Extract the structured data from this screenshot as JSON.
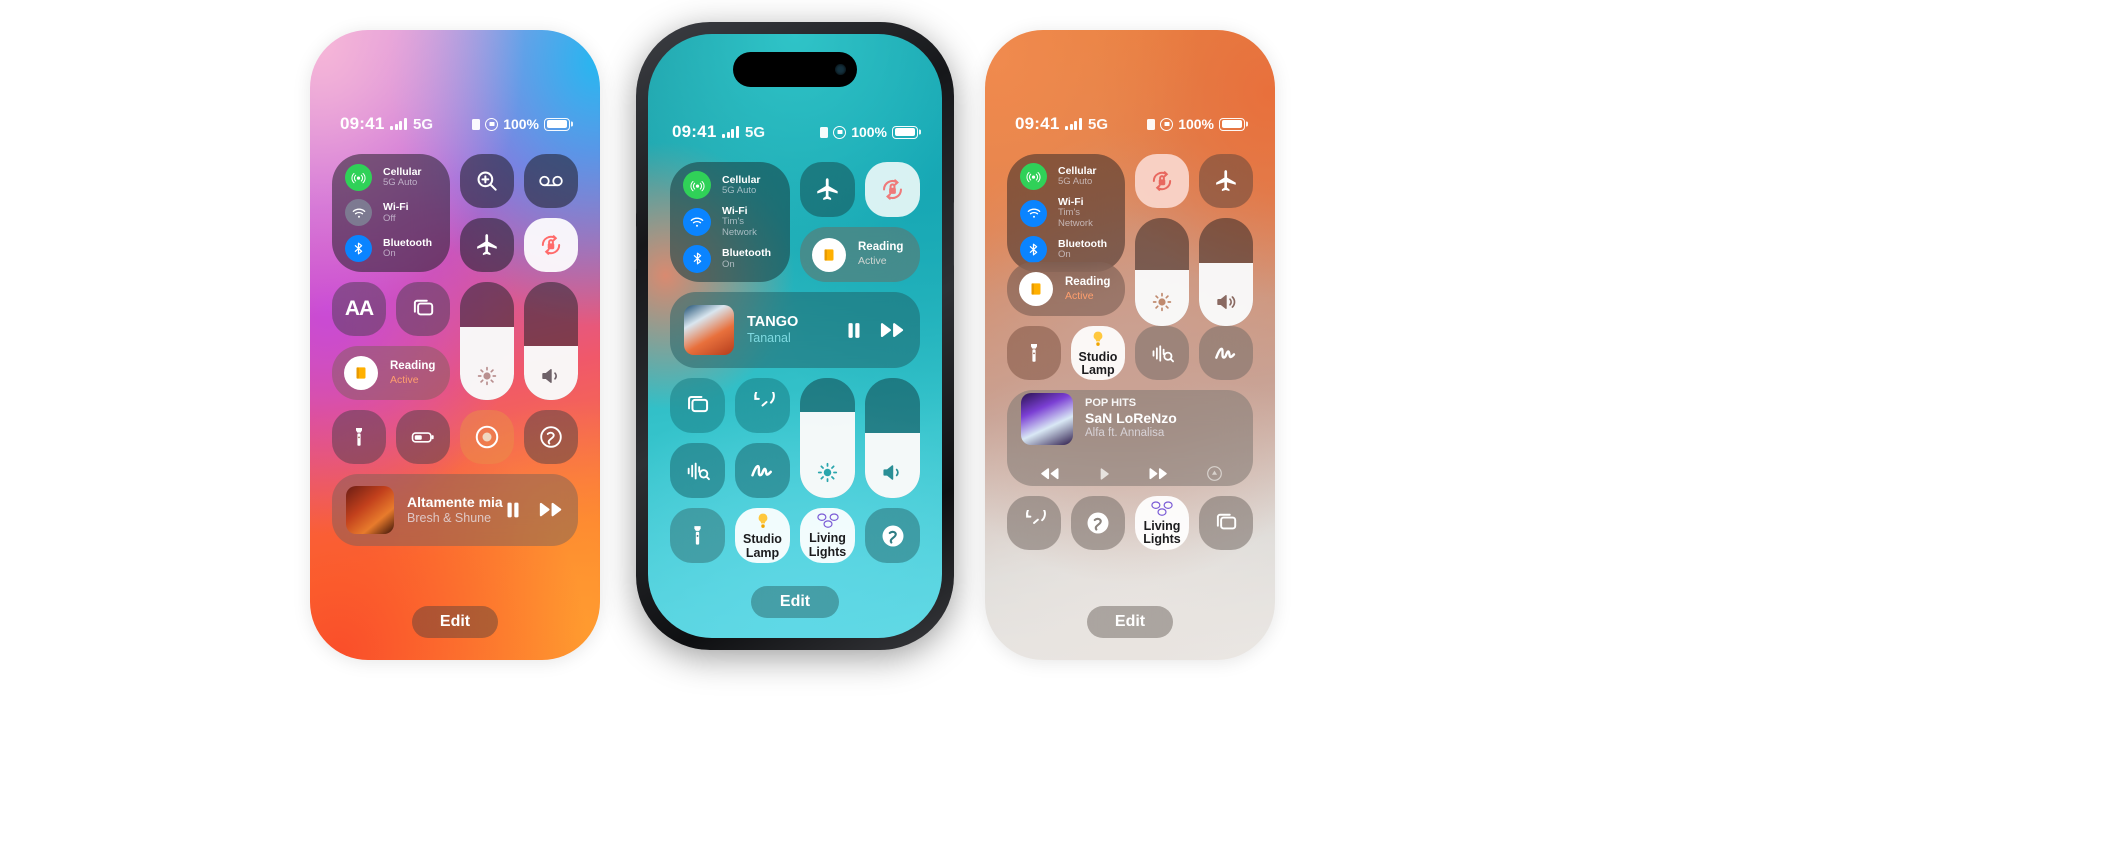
{
  "scene": {
    "background": "#ffffff",
    "description": "Three iPhones side by side showing iOS Control Center variants"
  },
  "phones": [
    {
      "id": "left",
      "statusbar": {
        "time": "09:41",
        "network": "5G",
        "battery_percent": "100%",
        "icons": [
          "signal-bars-icon",
          "sim-icon",
          "rotation-lock-icon",
          "battery-icon"
        ]
      },
      "connectivity": [
        {
          "name": "Cellular",
          "value": "5G Auto",
          "icon": "cellular-icon",
          "state": "on"
        },
        {
          "name": "Wi-Fi",
          "value": "Off",
          "icon": "wifi-icon",
          "state": "off"
        },
        {
          "name": "Bluetooth",
          "value": "On",
          "icon": "bluetooth-icon",
          "state": "on"
        }
      ],
      "top_buttons": [
        {
          "icon": "zoom-magnifier-icon",
          "state": "off"
        },
        {
          "icon": "voicemail-icon",
          "state": "off"
        },
        {
          "icon": "airplane-mode-icon",
          "state": "off"
        },
        {
          "icon": "rotation-lock-icon",
          "state": "on"
        }
      ],
      "mid_buttons": [
        {
          "icon": "text-size-icon",
          "label": "AA",
          "state": "off"
        },
        {
          "icon": "screen-mirroring-icon",
          "state": "off"
        }
      ],
      "focus": {
        "title": "Reading",
        "status": "Active",
        "icon": "reading-focus-icon"
      },
      "sliders": [
        {
          "icon": "brightness-icon",
          "name": "brightness-slider",
          "percent": 62
        },
        {
          "icon": "volume-icon",
          "name": "volume-slider",
          "percent": 46
        }
      ],
      "bottom_buttons": [
        {
          "icon": "flashlight-icon",
          "state": "off"
        },
        {
          "icon": "low-power-mode-icon",
          "state": "off"
        },
        {
          "icon": "sound-recognition-icon",
          "state": "off"
        },
        {
          "icon": "shazam-icon",
          "state": "off"
        }
      ],
      "now_playing": {
        "title": "Altamente mia",
        "artist": "Bresh & Shune",
        "controls": [
          "pause-button",
          "next-track-button"
        ]
      },
      "edit_label": "Edit"
    },
    {
      "id": "center",
      "statusbar": {
        "time": "09:41",
        "network": "5G",
        "battery_percent": "100%",
        "icons": [
          "signal-bars-icon",
          "sim-icon",
          "rotation-lock-icon",
          "battery-icon"
        ]
      },
      "connectivity": [
        {
          "name": "Cellular",
          "value": "5G Auto",
          "icon": "cellular-icon",
          "state": "on"
        },
        {
          "name": "Wi-Fi",
          "value": "Tim's Network",
          "icon": "wifi-icon",
          "state": "on"
        },
        {
          "name": "Bluetooth",
          "value": "On",
          "icon": "bluetooth-icon",
          "state": "on"
        }
      ],
      "top_buttons": [
        {
          "icon": "airplane-mode-icon",
          "state": "off"
        },
        {
          "icon": "rotation-lock-icon",
          "state": "on"
        }
      ],
      "focus": {
        "title": "Reading",
        "status": "Active",
        "icon": "reading-focus-icon"
      },
      "now_playing": {
        "title": "TANGO",
        "artist": "Tananal",
        "controls": [
          "pause-button",
          "next-track-button"
        ]
      },
      "mid_buttons": [
        {
          "icon": "screen-mirroring-icon",
          "state": "off"
        },
        {
          "icon": "timer-icon",
          "state": "off"
        },
        {
          "icon": "sound-recognition-icon",
          "state": "off"
        },
        {
          "icon": "freeform-scribble-icon",
          "state": "off"
        }
      ],
      "sliders": [
        {
          "icon": "brightness-icon",
          "name": "brightness-slider",
          "percent": 72
        },
        {
          "icon": "volume-icon",
          "name": "volume-slider",
          "percent": 54
        }
      ],
      "bottom_buttons": [
        {
          "icon": "flashlight-icon",
          "state": "off"
        },
        {
          "icon": "lamp-icon",
          "label": "Studio Lamp",
          "state": "on"
        },
        {
          "icon": "bulbs-icon",
          "label": "Living Lights",
          "state": "on"
        },
        {
          "icon": "shazam-icon",
          "state": "off"
        }
      ],
      "edit_label": "Edit"
    },
    {
      "id": "right",
      "statusbar": {
        "time": "09:41",
        "network": "5G",
        "battery_percent": "100%",
        "icons": [
          "signal-bars-icon",
          "sim-icon",
          "rotation-lock-icon",
          "battery-icon"
        ]
      },
      "connectivity": [
        {
          "name": "Cellular",
          "value": "5G Auto",
          "icon": "cellular-icon",
          "state": "on"
        },
        {
          "name": "Wi-Fi",
          "value": "Tim's Network",
          "icon": "wifi-icon",
          "state": "on"
        },
        {
          "name": "Bluetooth",
          "value": "On",
          "icon": "bluetooth-icon",
          "state": "on"
        }
      ],
      "top_buttons": [
        {
          "icon": "rotation-lock-icon",
          "state": "on"
        },
        {
          "icon": "airplane-mode-icon",
          "state": "off"
        }
      ],
      "focus": {
        "title": "Reading",
        "status": "Active",
        "icon": "reading-focus-icon"
      },
      "sliders": [
        {
          "icon": "brightness-icon",
          "name": "brightness-slider",
          "percent": 52
        },
        {
          "icon": "volume-icon",
          "name": "volume-slider",
          "percent": 58
        }
      ],
      "mid_buttons": [
        {
          "icon": "flashlight-icon",
          "state": "off"
        },
        {
          "icon": "lamp-icon",
          "label": "Studio Lamp",
          "state": "on"
        },
        {
          "icon": "sound-recognition-icon",
          "state": "off"
        },
        {
          "icon": "freeform-scribble-icon",
          "state": "off"
        }
      ],
      "now_playing": {
        "station": "POP HITS",
        "title": "SaN LoReNzo",
        "artist": "Alfa ft. Annalisa",
        "controls": [
          "previous-track-button",
          "play-button",
          "next-track-button",
          "airplay-button"
        ]
      },
      "bottom_buttons": [
        {
          "icon": "timer-icon",
          "state": "off"
        },
        {
          "icon": "shazam-icon",
          "state": "off"
        },
        {
          "icon": "bulbs-icon",
          "label": "Living Lights",
          "state": "on"
        },
        {
          "icon": "screen-mirroring-icon",
          "state": "off"
        }
      ],
      "edit_label": "Edit"
    }
  ],
  "colors": {
    "cellular_green": "#30d158",
    "bluetooth_blue": "#0a84ff",
    "wifi_blue": "#0a84ff",
    "wifi_off_gray": "#7d7a91",
    "focus_orange": "#ff9f6e",
    "lock_red": "#ff6b6b",
    "lamp_yellow": "#ffc83d",
    "bulb_purple": "#7b5cd6"
  }
}
